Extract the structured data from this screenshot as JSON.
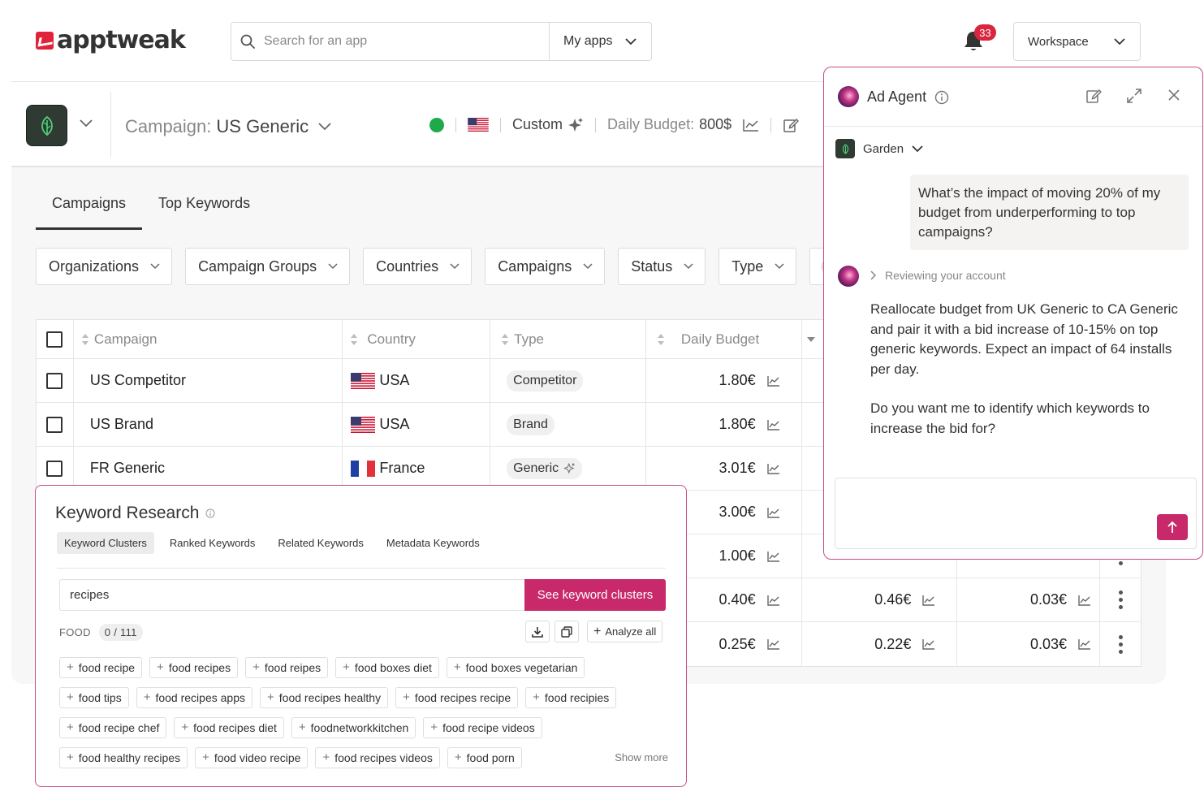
{
  "brand": {
    "name": "apptweak"
  },
  "topbar": {
    "search_placeholder": "Search for an app",
    "my_apps_label": "My apps",
    "notifications_count": "33",
    "workspace_label": "Workspace"
  },
  "campaign_header": {
    "label": "Campaign:",
    "name": "US Generic",
    "mode": "Custom",
    "budget_label": "Daily Budget:",
    "budget_value": "800$"
  },
  "tabs": [
    {
      "label": "Campaigns",
      "active": true
    },
    {
      "label": "Top Keywords",
      "active": false
    }
  ],
  "filters": [
    "Organizations",
    "Campaign Groups",
    "Countries",
    "Campaigns",
    "Status",
    "Type"
  ],
  "table": {
    "columns": [
      "Campaign",
      "Country",
      "Type",
      "Daily Budget"
    ],
    "rows": [
      {
        "campaign": "US Competitor",
        "country": "USA",
        "flag": "us",
        "type": "Competitor",
        "budget": "1.80€",
        "m1": "",
        "m2": ""
      },
      {
        "campaign": "US Brand",
        "country": "USA",
        "flag": "us",
        "type": "Brand",
        "budget": "1.80€",
        "m1": "",
        "m2": ""
      },
      {
        "campaign": "FR Generic",
        "country": "France",
        "flag": "fr",
        "type": "Generic",
        "budget": "3.01€",
        "m1": "",
        "m2": ""
      },
      {
        "campaign": "",
        "country": "",
        "flag": "",
        "type": "",
        "budget": "3.00€",
        "m1": "",
        "m2": ""
      },
      {
        "campaign": "",
        "country": "",
        "flag": "",
        "type": "",
        "budget": "1.00€",
        "m1": "",
        "m2": ""
      },
      {
        "campaign": "",
        "country": "",
        "flag": "",
        "type": "",
        "budget": "0.40€",
        "m1": "0.46€",
        "m2": "0.03€"
      },
      {
        "campaign": "",
        "country": "",
        "flag": "",
        "type": "",
        "budget": "0.25€",
        "m1": "0.22€",
        "m2": "0.03€"
      }
    ]
  },
  "keyword_research": {
    "title": "Keyword Research",
    "tabs": [
      "Keyword Clusters",
      "Ranked Keywords",
      "Related Keywords",
      "Metadata Keywords"
    ],
    "input_value": "recipes",
    "button_label": "See keyword clusters",
    "category_label": "FOOD",
    "count_label": "0 / 111",
    "analyze_label": "Analyze all",
    "keyword_rows": [
      [
        "food recipe",
        "food recipes",
        "food reipes",
        "food boxes diet",
        "food boxes vegetarian"
      ],
      [
        "food tips",
        "food recipes apps",
        "food recipes healthy",
        "food recipes recipe",
        "food recipies"
      ],
      [
        "food recipe chef",
        "food recipes diet",
        "foodnetworkkitchen",
        "food recipe videos"
      ],
      [
        "food healthy recipes",
        "food video recipe",
        "food recipes videos",
        "food porn"
      ]
    ],
    "show_more_label": "Show more"
  },
  "ad_agent": {
    "title": "Ad Agent",
    "app_selector": "Garden",
    "user_message": "What’s the impact of moving 20% of my budget from underperforming to top campaigns?",
    "status_text": "Reviewing your account",
    "reply_paragraph_1": "Reallocate budget from UK Generic to CA Generic and pair it with a bid increase of 10-15% on top generic keywords. Expect an impact of 64 installs per day.",
    "reply_paragraph_2": "Do you want me to identify which keywords to increase the bid for?",
    "input_value": ""
  },
  "colors": {
    "brand_red": "#e0223b",
    "accent_magenta": "#c8296a",
    "status_green": "#1eaa4b",
    "badge_red": "#d8263e",
    "app_icon_bg": "#2f3a33"
  }
}
